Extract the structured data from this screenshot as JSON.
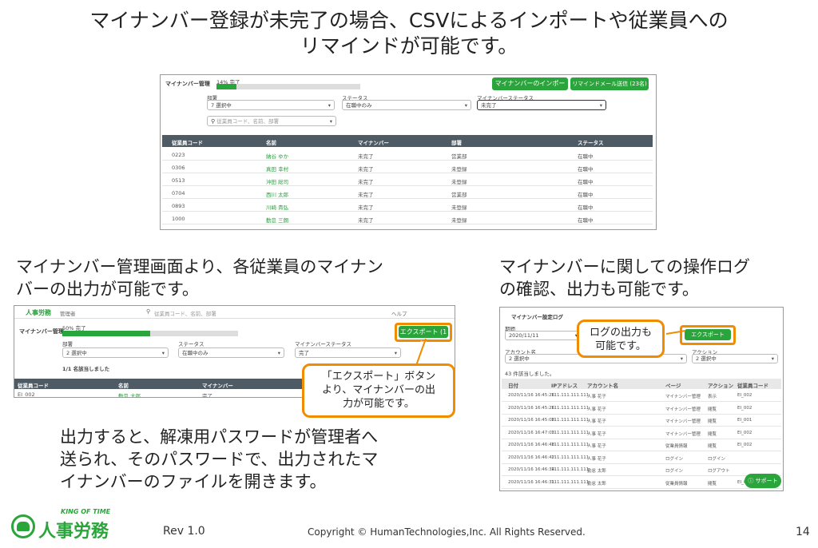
{
  "slide": {
    "title_line1": "マイナンバー登録が未完了の場合、CSVによるインポートや従業員への",
    "title_line2": "リマインドが可能です。",
    "caption_left_line1": "マイナンバー管理画面より、各従業員のマイナン",
    "caption_left_line2": "バーの出力が可能です。",
    "caption_right_line1": "マイナンバーに関しての操作ログ",
    "caption_right_line2": "の確認、出力も可能です。",
    "caption_bottom_line1": "出力すると、解凍用パスワードが管理者へ",
    "caption_bottom_line2": "送られ、そのパスワードで、出力されたマ",
    "caption_bottom_line3": "イナンバーのファイルを開きます。",
    "callout_export_line1": "「エクスポート」ボタン",
    "callout_export_line2": "より、マイナンバーの出",
    "callout_export_line3": "力が可能です。",
    "callout_log_line1": "ログの出力も",
    "callout_log_line2": "可能です。",
    "footer_rev": "Rev 1.0",
    "footer_copyright": "Copyright © HumanTechnologies,Inc. All Rights Reserved.",
    "page_number": "14",
    "logo_top": "KING OF TIME",
    "logo_main": "人事労務"
  },
  "shot1": {
    "title": "マイナンバー管理",
    "progress_label": "14% 完了",
    "progress": 0.14,
    "import_button": "マイナンバーのインポート",
    "remind_button": "リマインドメール送信 (23名)",
    "dept_label": "部署",
    "dept_value": "7 選択中",
    "status_label": "ステータス",
    "status_value": "在職中のみ",
    "mn_status_label": "マイナンバーステータス",
    "mn_status_value": "未完了",
    "search_placeholder": "従業員コード、名前、部署",
    "headers": [
      "従業員コード",
      "名前",
      "マイナンバー",
      "部署",
      "ステータス"
    ],
    "rows": [
      [
        "0223",
        "納谷 ゆか",
        "未完了",
        "営業部",
        "在職中"
      ],
      [
        "0306",
        "真田 幸村",
        "未完了",
        "未登録",
        "在職中"
      ],
      [
        "0513",
        "沖田 総司",
        "未完了",
        "未登録",
        "在職中"
      ],
      [
        "0704",
        "西川 太郎",
        "未完了",
        "営業部",
        "在職中"
      ],
      [
        "0893",
        "川崎 貴弘",
        "未完了",
        "未登録",
        "在職中"
      ],
      [
        "1000",
        "勤怠 三朗",
        "未完了",
        "未登録",
        "在職中"
      ]
    ]
  },
  "shot2": {
    "logo": "人事労務",
    "menu": "管理者",
    "search_placeholder": "従業員コード、名前、部署",
    "help": "ヘルプ",
    "title": "マイナンバー管理",
    "progress_label": "50% 完了",
    "progress": 0.5,
    "export_button": "エクスポート (1名)",
    "dept_label": "部署",
    "dept_value": "2 選択中",
    "status_label": "ステータス",
    "status_value": "在職中のみ",
    "mn_status_label": "マイナンバーステータス",
    "mn_status_value": "完了",
    "result_text": "1/1 名該当しました",
    "headers": [
      "従業員コード",
      "名前",
      "マイナンバー"
    ],
    "row": [
      "EI_002",
      "勤怠 太郎",
      "完了"
    ]
  },
  "shot3": {
    "title": "マイナンバー設定ログ",
    "date_label": "期間",
    "date_value": "2020/11/11",
    "export_button": "エクスポート",
    "account_label": "アカウント名",
    "account_value": "2 選択中",
    "action_label": "アクション",
    "action_value": "2 選択中",
    "count_text": "43 件該当しました。",
    "headers": [
      "日付",
      "IPアドレス",
      "アカウント名",
      "ページ",
      "アクション",
      "従業員コード"
    ],
    "rows": [
      [
        "2020/11/16 16:45:26",
        "111.111.111.111",
        "人事 花子",
        "マイナンバー管理",
        "表示",
        "EI_002"
      ],
      [
        "2020/11/16 16:45:26",
        "111.111.111.111",
        "人事 花子",
        "マイナンバー管理",
        "閲覧",
        "EI_002"
      ],
      [
        "2020/11/16 16:45:08",
        "111.111.111.111",
        "人事 花子",
        "マイナンバー管理",
        "閲覧",
        "EI_001"
      ],
      [
        "2020/11/16 16:47:03",
        "111.111.111.111",
        "人事 花子",
        "マイナンバー管理",
        "閲覧",
        "EI_002"
      ],
      [
        "2020/11/16 16:46:48",
        "111.111.111.111",
        "人事 花子",
        "従業員情報",
        "閲覧",
        "EI_002"
      ],
      [
        "2020/11/16 16:46:42",
        "111.111.111.111",
        "人事 花子",
        "ログイン",
        "ログイン",
        ""
      ],
      [
        "2020/11/16 16:46:34",
        "111.111.111.111",
        "勤怠 太郎",
        "ログイン",
        "ログアウト",
        ""
      ],
      [
        "2020/11/16 16:46:31",
        "111.111.111.111",
        "勤怠 太郎",
        "従業員情報",
        "閲覧",
        "EI_002"
      ]
    ],
    "support_button": "サポート"
  }
}
